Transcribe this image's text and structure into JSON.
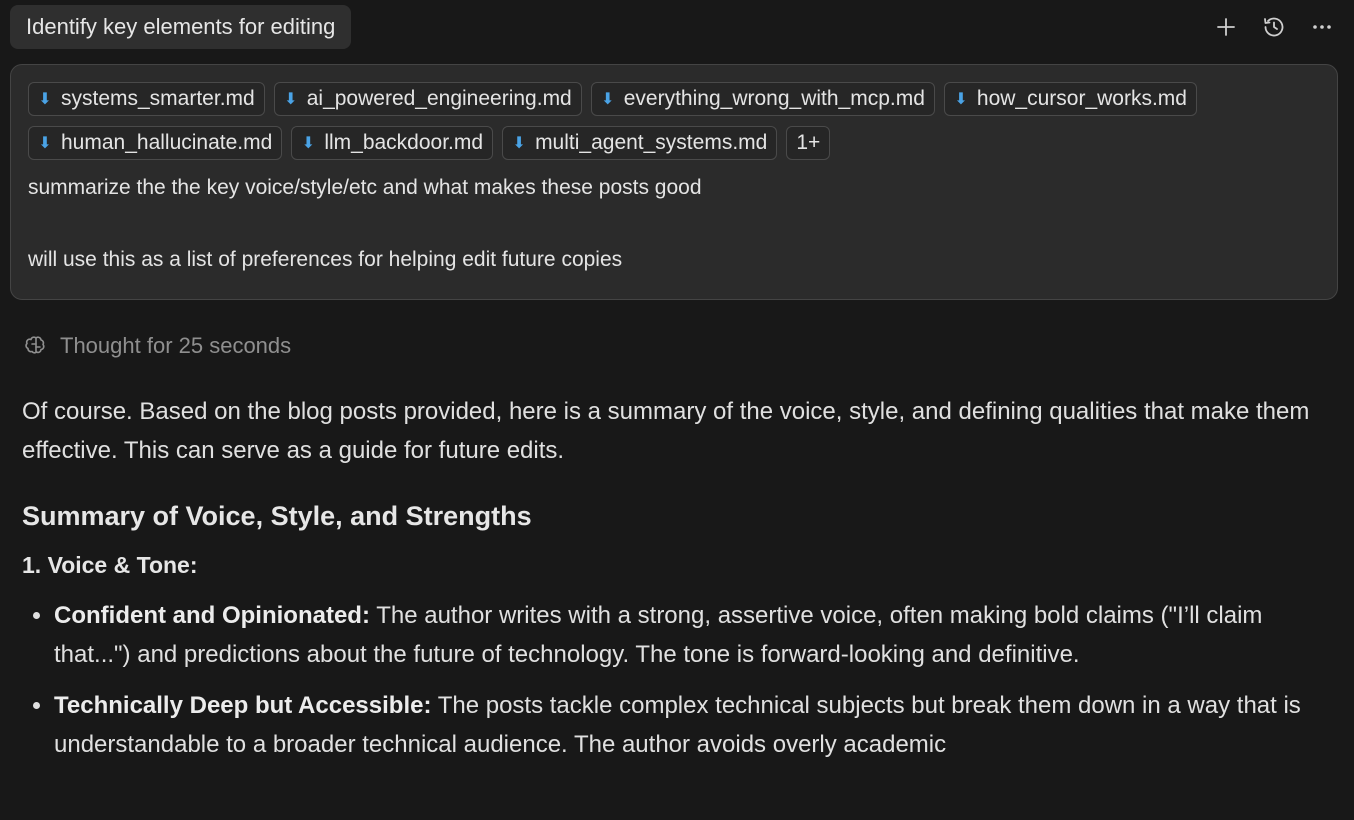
{
  "header": {
    "title": "Identify key elements for editing",
    "actions": [
      {
        "name": "new-chat-button",
        "icon": "plus-icon"
      },
      {
        "name": "history-button",
        "icon": "history-icon"
      },
      {
        "name": "more-button",
        "icon": "ellipsis-icon"
      }
    ]
  },
  "prompt": {
    "attachments": [
      "systems_smarter.md",
      "ai_powered_engineering.md",
      "everything_wrong_with_mcp.md",
      "how_cursor_works.md",
      "human_hallucinate.md",
      "llm_backdoor.md",
      "multi_agent_systems.md"
    ],
    "more_label": "1+",
    "lines": [
      "summarize the the key voice/style/etc and what makes these posts good",
      "will use this as a list of preferences for helping edit future copies"
    ]
  },
  "thought": {
    "label": "Thought for 25 seconds",
    "icon": "brain-icon"
  },
  "response": {
    "intro": "Of course. Based on the blog posts provided, here is a summary of the voice, style, and defining qualities that make them effective. This can serve as a guide for future edits.",
    "heading": "Summary of Voice, Style, and Strengths",
    "section1": "1. Voice & Tone:",
    "bullets": [
      {
        "bold": "Confident and Opinionated:",
        "text": " The author writes with a strong, assertive voice, often making bold claims (\"I’ll claim that...\") and predictions about the future of technology. The tone is forward-looking and definitive."
      },
      {
        "bold": "Technically Deep but Accessible:",
        "text": " The posts tackle complex technical subjects but break them down in a way that is understandable to a broader technical audience. The author avoids overly academic"
      }
    ]
  },
  "colors": {
    "background": "#181818",
    "panel": "#2b2b2b",
    "md_icon": "#4aa3e6"
  }
}
